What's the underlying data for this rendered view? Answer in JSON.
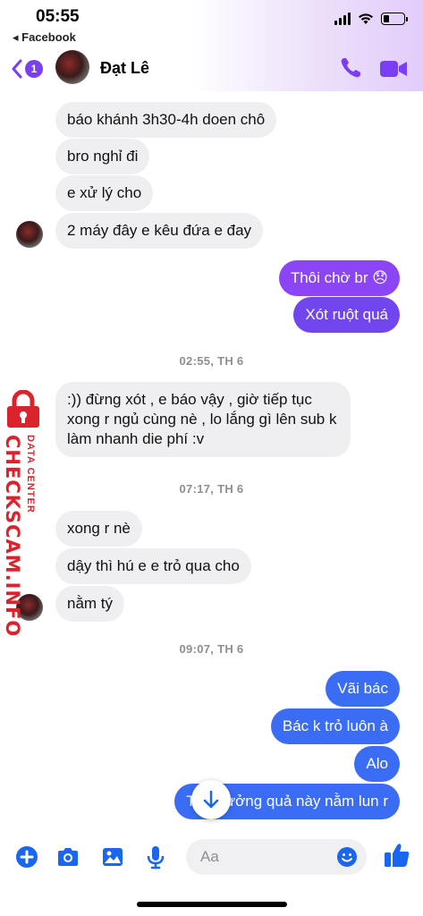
{
  "status_bar": {
    "time": "05:55",
    "back_app": "◂ Facebook",
    "battery_level": 0.3
  },
  "header": {
    "unread_badge": "1",
    "contact_name": "Đạt Lê",
    "icons": [
      "back-chevron-icon",
      "phone-icon",
      "video-camera-icon"
    ]
  },
  "messages": [
    {
      "side": "in",
      "text": "báo khánh 3h30-4h doen chô"
    },
    {
      "side": "in",
      "text": "bro nghỉ đi"
    },
    {
      "side": "in",
      "text": "e xử lý cho"
    },
    {
      "side": "in",
      "text": "2 máy đây e kêu đứa e đay"
    },
    {
      "side": "out",
      "text": "Thôi chờ br 😞"
    },
    {
      "side": "out",
      "text": "Xót ruột quá"
    },
    {
      "side": "time",
      "text": "02:55, TH 6"
    },
    {
      "side": "in",
      "text": ":)) đừng xót , e báo vậy , giờ tiếp tục xong r ngủ cùng nè , lo lắng gì lên sub k làm nhanh die phí :v"
    },
    {
      "side": "time",
      "text": "07:17, TH 6"
    },
    {
      "side": "in",
      "text": "xong r nè"
    },
    {
      "side": "in",
      "text": "dậy thì hú e e trỏ qua cho"
    },
    {
      "side": "in",
      "text": "nằm tý"
    },
    {
      "side": "time",
      "text": "09:07, TH 6"
    },
    {
      "side": "out",
      "text": "Vãi bác"
    },
    {
      "side": "out",
      "text": "Bác k trỏ luôn à"
    },
    {
      "side": "out",
      "text": "Alo"
    },
    {
      "side": "out",
      "text": "Thế hưởng quả này nằm lun r"
    }
  ],
  "watermark": {
    "text": "CHECKSCAM.INFO",
    "sub": "DATA CENTER"
  },
  "composer": {
    "placeholder": "Aa",
    "icons": [
      "plus-icon",
      "camera-icon",
      "gallery-icon",
      "microphone-icon",
      "emoji-icon",
      "thumbs-up-icon"
    ]
  },
  "colors": {
    "accent": "#7b3ff2",
    "outgoing_top": "#8b45f5",
    "outgoing_bottom": "#3b6cf4",
    "incoming": "#efeff1"
  }
}
